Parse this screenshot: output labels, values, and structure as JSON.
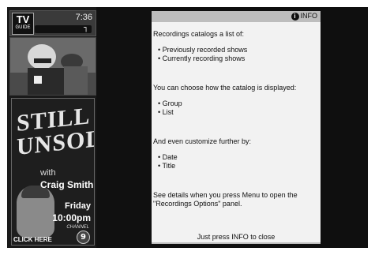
{
  "branding": {
    "tv": "TV",
    "guide": "GUIDE"
  },
  "clock": "7:36",
  "topbar_glyph": "┐",
  "promo": {
    "title_line1": "STILL",
    "title_line2": "UNSOLVED",
    "with": "with",
    "host": "Craig Smith",
    "day": "Friday",
    "time": "10:00pm",
    "channel_label": "CHANNEL",
    "channel_number": "9",
    "cta": "CLICK HERE"
  },
  "panel": {
    "header_label": "INFO",
    "intro": "Recordings catalogs a list of:",
    "list1": [
      "Previously recorded shows",
      "Currently recording shows"
    ],
    "choose": "You can choose how the catalog is displayed:",
    "list2": [
      "Group",
      "List"
    ],
    "customize": "And even customize further by:",
    "list3": [
      "Date",
      "Title"
    ],
    "details": "See details when you press Menu to open the \"Recordings Options\" panel.",
    "close_hint": "Just press INFO to close"
  },
  "colors": {
    "panel_bg": "#f2f2f2",
    "panel_header": "#bdbdbd",
    "screen_bg": "#0f0f0f"
  }
}
